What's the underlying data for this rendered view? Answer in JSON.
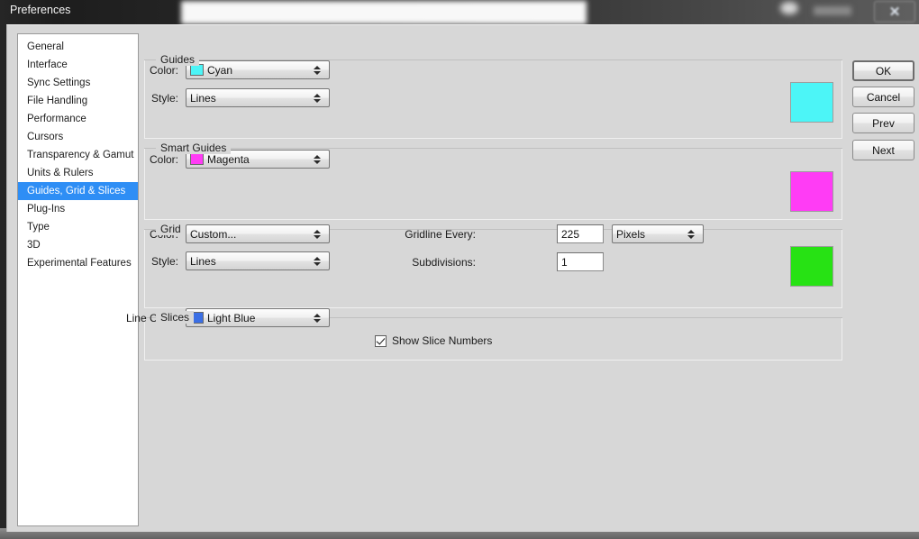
{
  "window": {
    "title": "Preferences",
    "close_icon": "close-icon",
    "close_label": "✕"
  },
  "sidebar": {
    "items": [
      {
        "label": "General",
        "selected": false
      },
      {
        "label": "Interface",
        "selected": false
      },
      {
        "label": "Sync Settings",
        "selected": false
      },
      {
        "label": "File Handling",
        "selected": false
      },
      {
        "label": "Performance",
        "selected": false
      },
      {
        "label": "Cursors",
        "selected": false
      },
      {
        "label": "Transparency & Gamut",
        "selected": false
      },
      {
        "label": "Units & Rulers",
        "selected": false
      },
      {
        "label": "Guides, Grid & Slices",
        "selected": true
      },
      {
        "label": "Plug-Ins",
        "selected": false
      },
      {
        "label": "Type",
        "selected": false
      },
      {
        "label": "3D",
        "selected": false
      },
      {
        "label": "Experimental Features",
        "selected": false
      }
    ],
    "selected_color": "#2e8ef5"
  },
  "groups": {
    "guides": {
      "title": "Guides",
      "color_label": "Color:",
      "color_value": "Cyan",
      "color_hex": "#4cf5f7",
      "style_label": "Style:",
      "style_value": "Lines",
      "preview_hex": "#4cf5f7"
    },
    "smart_guides": {
      "title": "Smart Guides",
      "color_label": "Color:",
      "color_value": "Magenta",
      "color_hex": "#ff3cf5",
      "preview_hex": "#ff3cf5"
    },
    "grid": {
      "title": "Grid",
      "color_label": "Color:",
      "color_value": "Custom...",
      "style_label": "Style:",
      "style_value": "Lines",
      "gridline_label": "Gridline Every:",
      "gridline_value": "225",
      "unit_value": "Pixels",
      "subdivisions_label": "Subdivisions:",
      "subdivisions_value": "1",
      "preview_hex": "#27e214"
    },
    "slices": {
      "title": "Slices",
      "line_color_label": "Line Color:",
      "line_color_value": "Light Blue",
      "line_color_hex": "#3b6fe5",
      "checkbox_label": "Show Slice Numbers",
      "checkbox_checked": true
    }
  },
  "buttons": {
    "ok": "OK",
    "cancel": "Cancel",
    "prev": "Prev",
    "next": "Next"
  }
}
